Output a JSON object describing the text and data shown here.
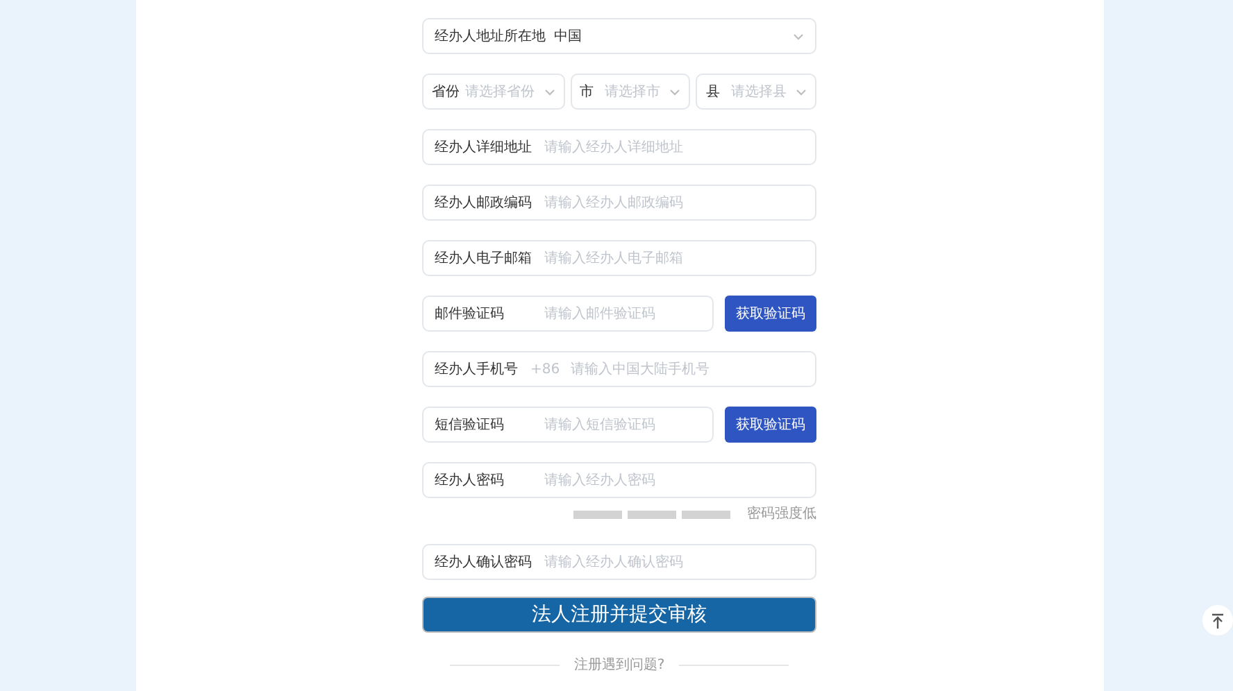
{
  "fields": [
    {
      "kind": "select",
      "label": "经办人地址所在地",
      "value": "中国"
    },
    {
      "kind": "region",
      "parts": [
        {
          "label": "省份",
          "placeholder": "请选择省份"
        },
        {
          "label": "市",
          "placeholder": "请选择市"
        },
        {
          "label": "县",
          "placeholder": "请选择县"
        }
      ]
    },
    {
      "kind": "input",
      "label": "经办人详细地址",
      "placeholder": "请输入经办人详细地址"
    },
    {
      "kind": "input",
      "label": "经办人邮政编码",
      "placeholder": "请输入经办人邮政编码"
    },
    {
      "kind": "input",
      "label": "经办人电子邮箱",
      "placeholder": "请输入经办人电子邮箱"
    },
    {
      "kind": "code",
      "label": "邮件验证码",
      "placeholder": "请输入邮件验证码",
      "button": "获取验证码"
    },
    {
      "kind": "phone",
      "label": "经办人手机号",
      "prefix": "+86",
      "placeholder": "请输入中国大陆手机号"
    },
    {
      "kind": "code",
      "label": "短信验证码",
      "placeholder": "请输入短信验证码",
      "button": "获取验证码"
    },
    {
      "kind": "input",
      "label": "经办人密码",
      "placeholder": "请输入经办人密码"
    },
    {
      "kind": "strength",
      "segments": [
        {
          "filled": false
        },
        {
          "filled": false
        },
        {
          "filled": false
        }
      ],
      "label": "密码强度低"
    },
    {
      "kind": "input",
      "label": "经办人确认密码",
      "placeholder": "请输入经办人确认密码"
    }
  ],
  "submit": "法人注册并提交审核",
  "help": "注册遇到问题?"
}
